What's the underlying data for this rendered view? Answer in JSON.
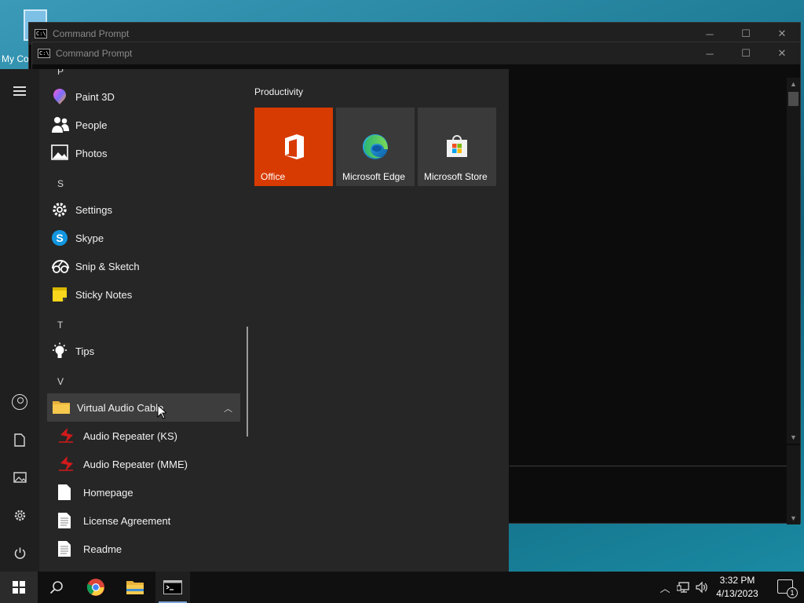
{
  "desktop": {
    "icon_label": "My Co"
  },
  "windows": [
    {
      "title": "Command Prompt"
    },
    {
      "title": "Command Prompt"
    }
  ],
  "window_controls": {
    "minimize": "─",
    "maximize": "☐",
    "close": "✕"
  },
  "start_menu": {
    "rail": [
      "menu",
      "account",
      "documents",
      "pictures",
      "settings",
      "power"
    ],
    "partial_letter": "P",
    "apps": [
      {
        "label": "Paint 3D",
        "icon": "paint3d-icon"
      },
      {
        "label": "People",
        "icon": "people-icon"
      },
      {
        "label": "Photos",
        "icon": "photos-icon"
      }
    ],
    "letter_s": "S",
    "apps_s": [
      {
        "label": "Settings",
        "icon": "gear-icon"
      },
      {
        "label": "Skype",
        "icon": "skype-icon"
      },
      {
        "label": "Snip & Sketch",
        "icon": "snip-sketch-icon"
      },
      {
        "label": "Sticky Notes",
        "icon": "sticky-notes-icon"
      }
    ],
    "letter_t": "T",
    "apps_t": [
      {
        "label": "Tips",
        "icon": "lightbulb-icon"
      }
    ],
    "letter_v": "V",
    "folder": {
      "label": "Virtual Audio Cable",
      "expanded": true
    },
    "folder_items": [
      {
        "label": "Audio Repeater (KS)",
        "icon": "audio-repeater-icon"
      },
      {
        "label": "Audio Repeater (MME)",
        "icon": "audio-repeater-icon"
      },
      {
        "label": "Homepage",
        "icon": "document-icon"
      },
      {
        "label": "License Agreement",
        "icon": "text-document-icon"
      },
      {
        "label": "Readme",
        "icon": "text-document-icon"
      }
    ],
    "tile_group": "Productivity",
    "tiles": [
      {
        "label": "Office",
        "color": "#d83b01"
      },
      {
        "label": "Microsoft Edge",
        "color": "#3a3a3a"
      },
      {
        "label": "Microsoft Store",
        "color": "#3a3a3a"
      }
    ]
  },
  "taskbar": {
    "pinned": [
      "start",
      "search",
      "chrome",
      "file-explorer",
      "command-prompt"
    ],
    "clock": {
      "time": "3:32 PM",
      "date": "4/13/2023"
    },
    "notification_count": "1"
  }
}
